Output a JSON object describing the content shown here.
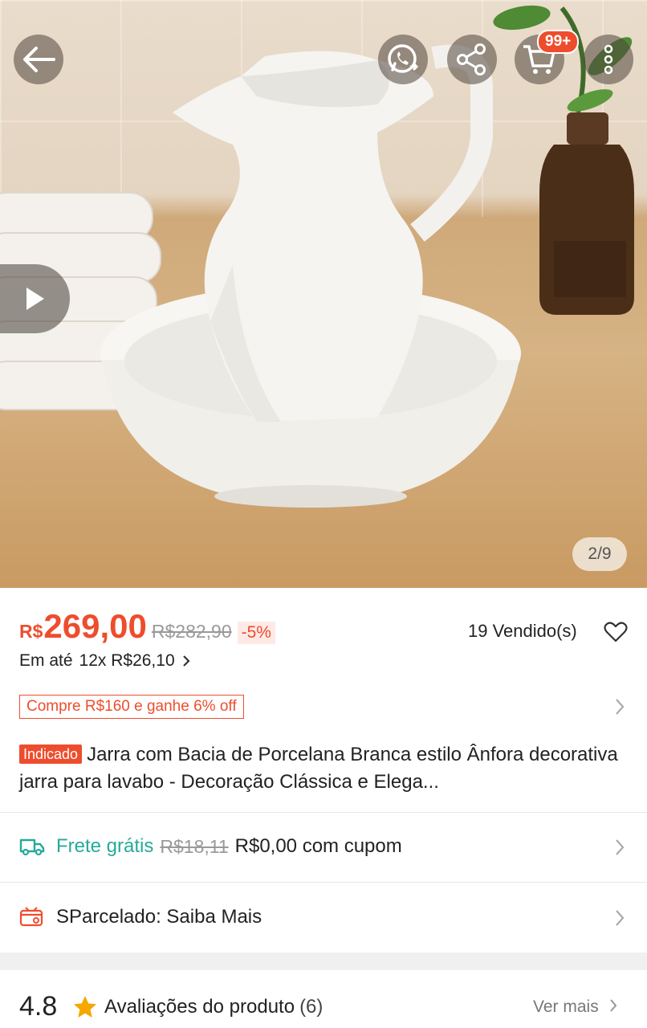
{
  "header": {
    "cart_badge": "99+"
  },
  "gallery": {
    "counter": "2/9"
  },
  "price": {
    "currency": "R$",
    "current": "269,00",
    "original": "R$282,90",
    "discount": "-5%",
    "sold": "19 Vendido(s)",
    "installment_prefix": "Em até",
    "installment_value": "12x R$26,10"
  },
  "promo": {
    "label": "Compre R$160 e ganhe 6% off"
  },
  "product": {
    "tag": "Indicado",
    "title": "Jarra com Bacia de Porcelana Branca estilo Ânfora decorativa jarra para lavabo - Decoração Clássica e Elega..."
  },
  "shipping": {
    "free_label": "Frete grátis",
    "old_fee": "R$18,11",
    "new_fee": "R$0,00 com cupom"
  },
  "sparcelado": {
    "label": "SParcelado: Saiba Mais"
  },
  "ratings": {
    "score": "4.8",
    "label": "Avaliações do produto",
    "count": "(6)",
    "see_more": "Ver mais"
  },
  "colors": {
    "accent": "#ee4d2d",
    "shipping_green": "#26aa99",
    "star": "#f6a700"
  }
}
